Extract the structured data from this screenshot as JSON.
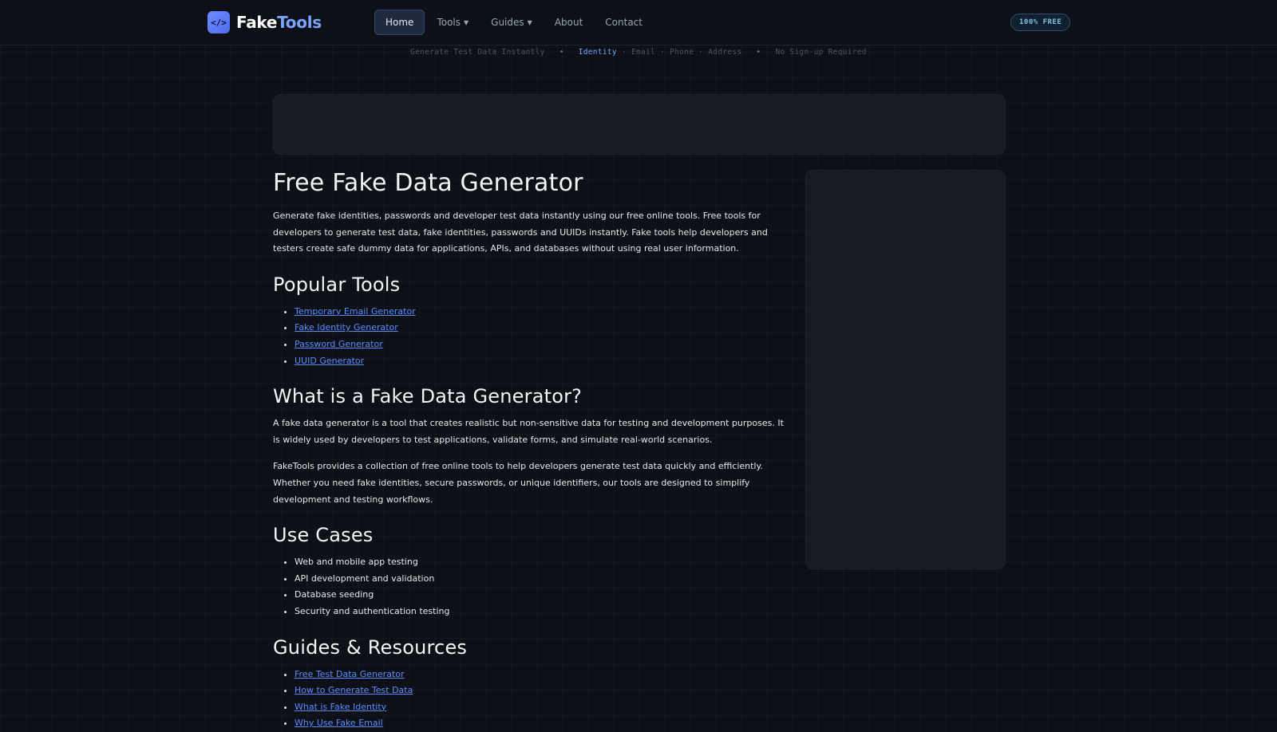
{
  "nav": {
    "logo_icon": "</>",
    "logo_part1": "Fake",
    "logo_part2": "Tools",
    "items": [
      {
        "label": "Home",
        "active": true
      },
      {
        "label": "Tools",
        "dropdown": true
      },
      {
        "label": "Guides",
        "dropdown": true
      },
      {
        "label": "About"
      },
      {
        "label": "Contact"
      }
    ],
    "badge": "100% FREE"
  },
  "ticker": {
    "item1": "Generate Test Data Instantly",
    "sep": "•",
    "item2_highlight": "Identity",
    "item2_rest": " · Email · Phone · Address",
    "item3": "No Sign-up Required"
  },
  "main": {
    "title": "Free Fake Data Generator",
    "intro": "Generate fake identities, passwords and developer test data instantly using our free online tools. Free tools for developers to generate test data, fake identities, passwords and UUIDs instantly. Fake tools help developers and testers create safe dummy data for applications, APIs, and databases without using real user information.",
    "popular_heading": "Popular Tools",
    "popular_tools": [
      "Temporary Email Generator",
      "Fake Identity Generator",
      "Password Generator",
      "UUID Generator"
    ],
    "what_heading": "What is a Fake Data Generator?",
    "what_p1": "A fake data generator is a tool that creates realistic but non-sensitive data for testing and development purposes. It is widely used by developers to test applications, validate forms, and simulate real-world scenarios.",
    "what_p2": "FakeTools provides a collection of free online tools to help developers generate test data quickly and efficiently. Whether you need fake identities, secure passwords, or unique identifiers, our tools are designed to simplify development and testing workflows.",
    "usecases_heading": "Use Cases",
    "usecases": [
      "Web and mobile app testing",
      "API development and validation",
      "Database seeding",
      "Security and authentication testing"
    ],
    "guides_heading": "Guides & Resources",
    "guides": [
      "Free Test Data Generator",
      "How to Generate Test Data",
      "What is Fake Identity",
      "Why Use Fake Email"
    ]
  }
}
